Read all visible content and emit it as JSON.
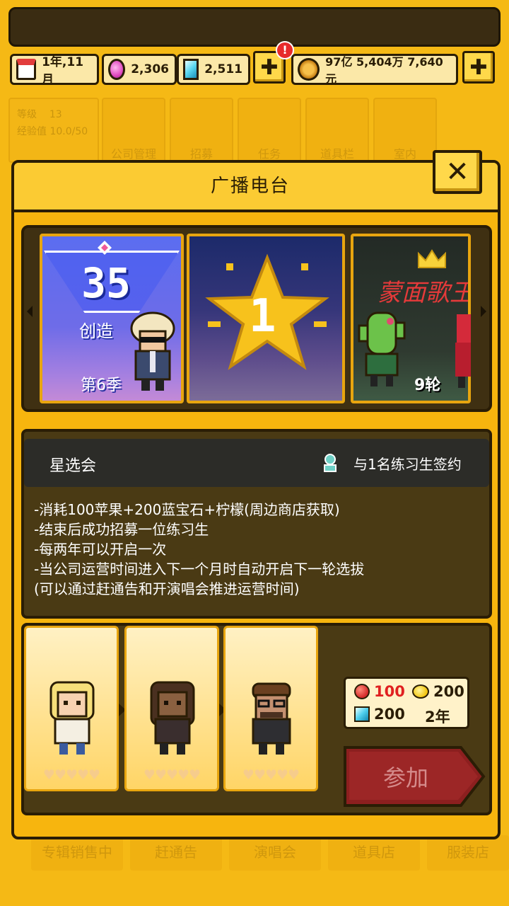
{
  "top_bar": {
    "date": "1年,11月",
    "pink_gems": "2,306",
    "blue_gems": "2,511",
    "notification": "!",
    "money": "97亿 5,404万 7,640元",
    "plus": "✚"
  },
  "background_menu": {
    "level_label": "等级",
    "level_value": "13",
    "exp_label": "经验值 10.0/50",
    "tiles": [
      "公司管理",
      "招募",
      "任务",
      "道具栏",
      "室内"
    ],
    "bottom_tabs": [
      "专辑销售中",
      "赶通告",
      "演唱会",
      "道具店",
      "服装店"
    ]
  },
  "modal": {
    "title": "广播电台",
    "close": "✕"
  },
  "carousel": {
    "card1": {
      "number": "35",
      "subtitle": "创造",
      "season": "第6季"
    },
    "card2": {
      "number": "1"
    },
    "card3": {
      "title": "蒙面歌王",
      "rounds": "9轮"
    }
  },
  "event": {
    "name": "星选会",
    "sign_text": "与1名练习生签约",
    "rules": [
      "-消耗100苹果+200蓝宝石+柠檬(周边商店获取)",
      "-结束后成功招募一位练习生",
      "-每两年可以开启一次",
      "-当公司运营时间进入下一个月时自动开启下一轮选拔",
      "(可以通过赶通告和开演唱会推进运营时间)"
    ]
  },
  "participants": {
    "hearts": "♥♥♥♥♥"
  },
  "cost": {
    "apple": "100",
    "lemon": "200",
    "sapphire": "200",
    "period": "2年"
  },
  "join_button": {
    "label": "参加"
  },
  "colors": {
    "background": "#f5b915",
    "panel_dark": "#4a3a14",
    "outline": "#2a1d05",
    "apple_red": "#e02020",
    "join_red": "#8c1f1f"
  }
}
